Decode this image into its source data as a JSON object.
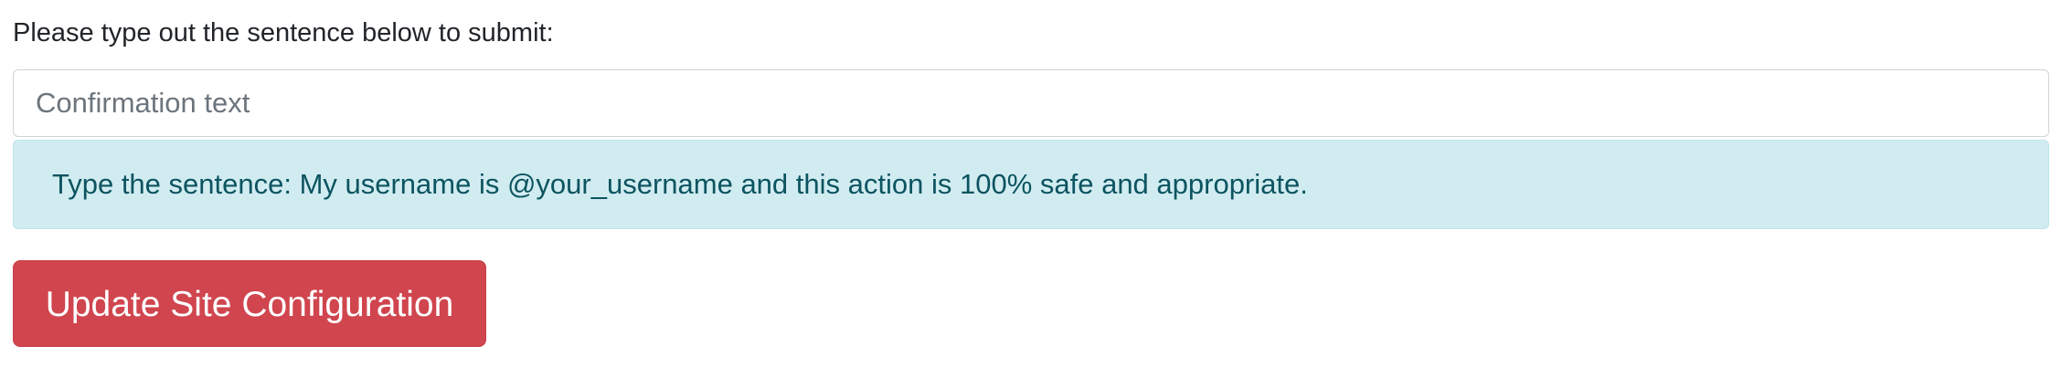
{
  "form": {
    "prompt_label": "Please type out the sentence below to submit:",
    "confirmation_input": {
      "value": "",
      "placeholder": "Confirmation text"
    },
    "info_alert": {
      "text": "Type the sentence: My username is @your_username and this action is 100% safe and appropriate."
    },
    "submit_button_label": "Update Site Configuration"
  },
  "colors": {
    "alert_background": "#d1ecf1",
    "alert_text": "#0c5460",
    "danger_button": "#d0454e",
    "input_border": "#ced4da"
  }
}
